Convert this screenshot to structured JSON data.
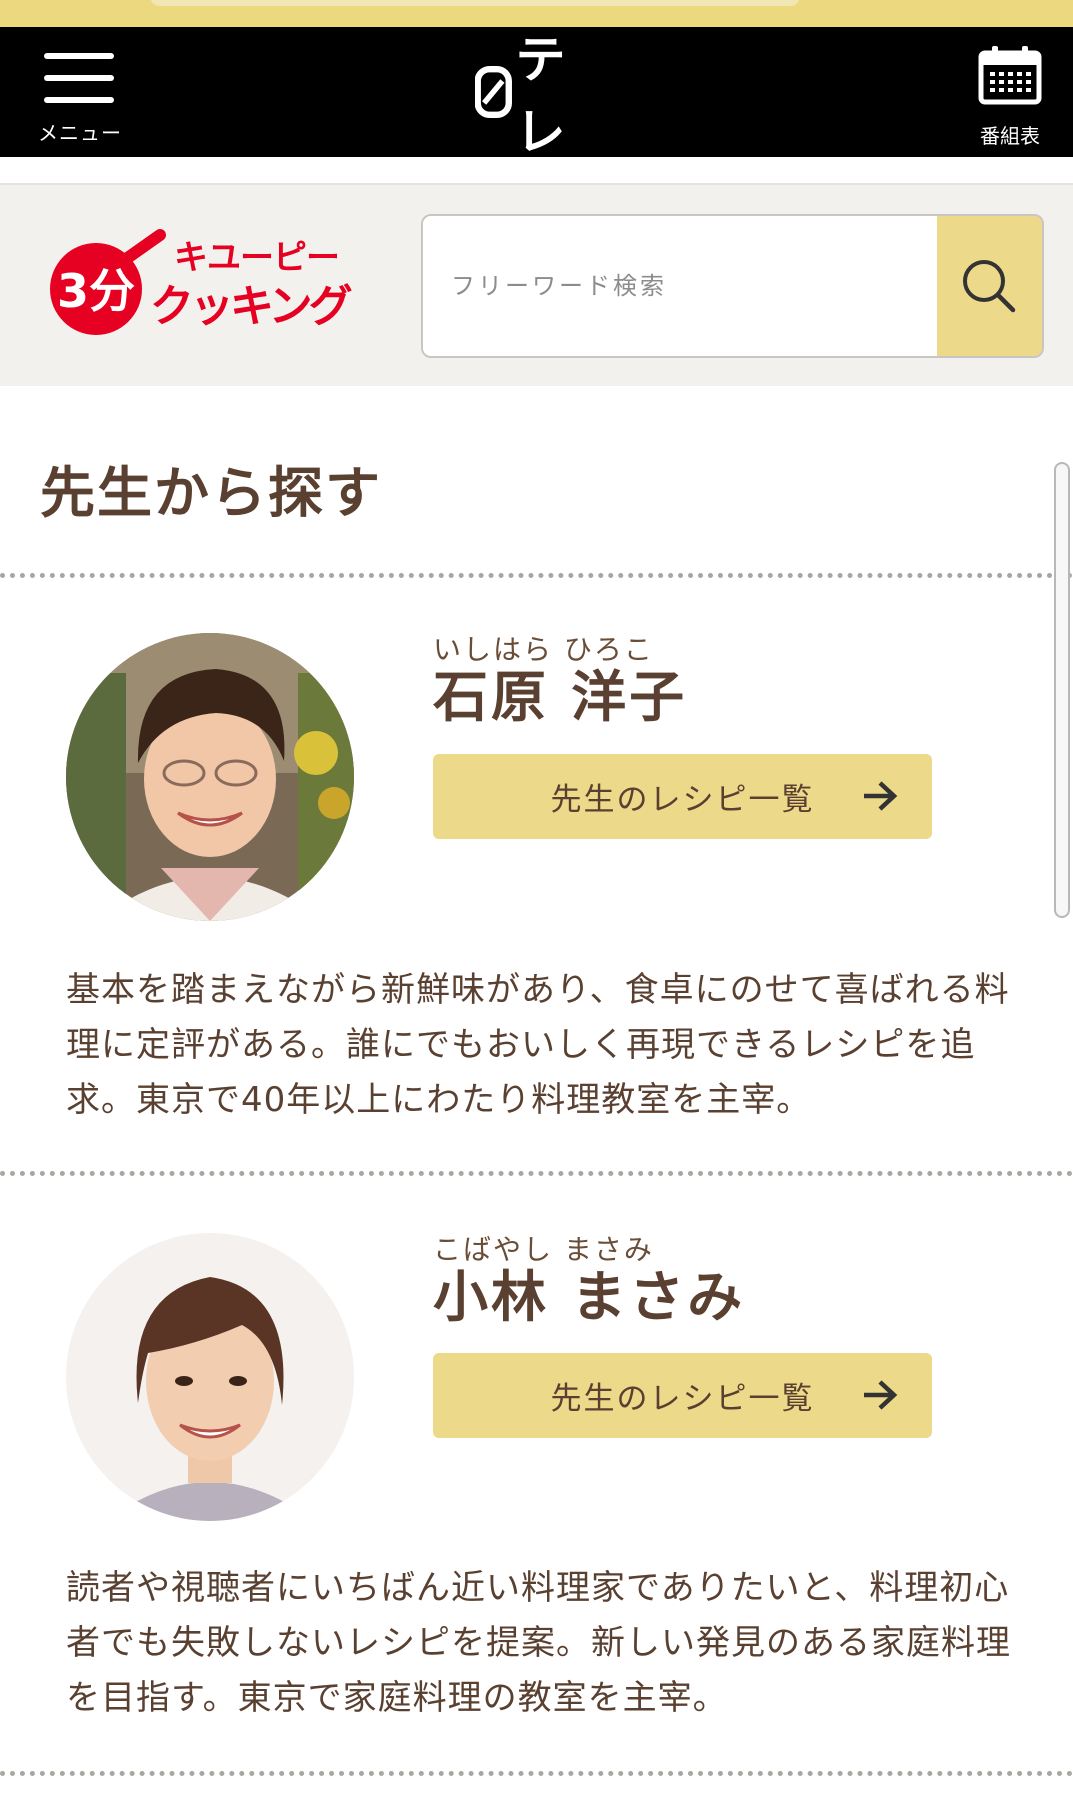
{
  "global_header": {
    "menu_label": "メニュー",
    "logo_text": "テレ",
    "schedule_label": "番組表"
  },
  "site": {
    "logo_top": "キユーピー",
    "logo_mark": "3分",
    "logo_bottom": "クッキング",
    "brand_color": "#e60021"
  },
  "search": {
    "placeholder": "フリーワード検索"
  },
  "section": {
    "title": "先生から探す"
  },
  "teachers": [
    {
      "ruby": "いしはら ひろこ",
      "name": "石原 洋子",
      "button_label": "先生のレシピ一覧",
      "description": "基本を踏まえながら新鮮味があり、食卓にのせて喜ばれる料理に定評がある。誰にでもおいしく再現できるレシピを追求。東京で40年以上にわたり料理教室を主宰。"
    },
    {
      "ruby": "こばやし まさみ",
      "name": "小林 まさみ",
      "button_label": "先生のレシピ一覧",
      "description": "読者や視聴者にいちばん近い料理家でありたいと、料理初心者でも失敗しないレシピを提案。新しい発見のある家庭料理を目指す。東京で家庭料理の教室を主宰。"
    }
  ],
  "colors": {
    "accent_yellow": "#ecd98a",
    "text_brown": "#5a4030",
    "header_black": "#000000"
  }
}
